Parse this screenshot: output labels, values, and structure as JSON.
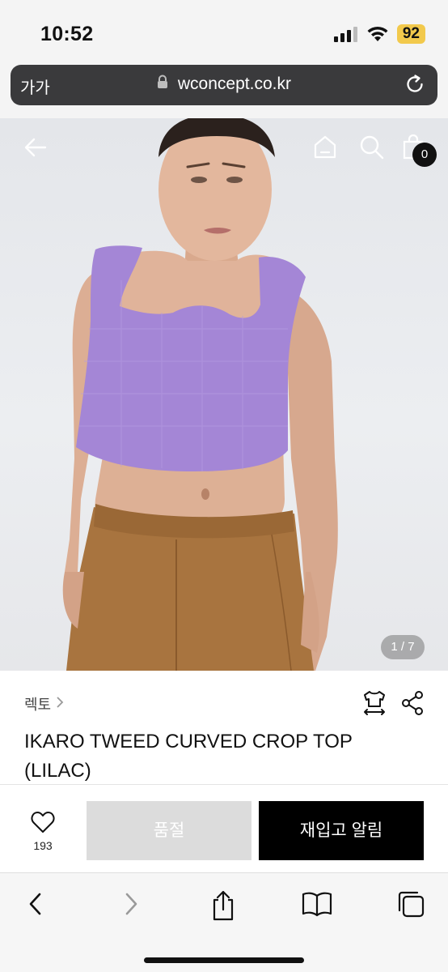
{
  "status": {
    "time": "10:52",
    "battery": "92"
  },
  "browser": {
    "text_size_label": "가가",
    "url": "wconcept.co.kr"
  },
  "header": {
    "bag_count": "0"
  },
  "gallery": {
    "indicator": "1 / 7"
  },
  "product": {
    "brand": "렉토",
    "title_line1": "IKARO TWEED CURVED CROP TOP",
    "title_line2": "(LILAC)"
  },
  "actions": {
    "like_count": "193",
    "soldout_label": "품절",
    "restock_label": "재입고 알림"
  },
  "colors": {
    "accent_black": "#000000",
    "soldout_gray": "#dcdcdc",
    "battery_yellow": "#f2c94c",
    "top_lilac": "#a486d6",
    "pants_tan": "#a8743f"
  }
}
